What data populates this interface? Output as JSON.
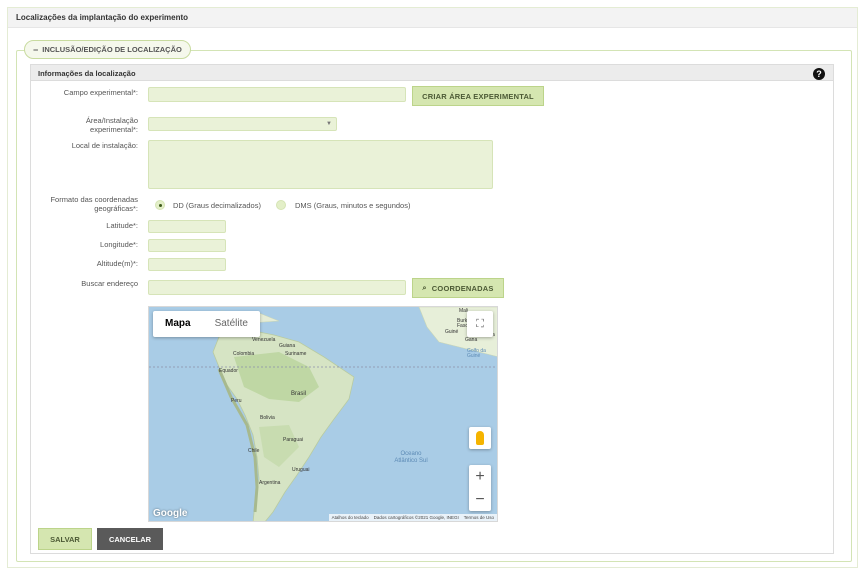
{
  "page": {
    "title": "Localizações da implantação do experimento"
  },
  "section": {
    "legend": "INCLUSÃO/EDIÇÃO DE LOCALIZAÇÃO",
    "collapse_symbol": "−"
  },
  "panel": {
    "title": "Informações da localização",
    "help_symbol": "?"
  },
  "form": {
    "campo_label": "Campo experimental*:",
    "campo_value": "",
    "criar_button": "CRIAR ÁREA EXPERIMENTAL",
    "area_label_line1": "Área/Instalação",
    "area_label_line2": "experimental*:",
    "area_value": "",
    "local_label": "Local de instalação:",
    "local_value": "",
    "formato_label_line1": "Formato das coordenadas",
    "formato_label_line2": "geográficas*:",
    "formato_options": [
      "DD (Graus decimalizados)",
      "DMS (Graus, minutos e segundos)"
    ],
    "formato_selected": "DD (Graus decimalizados)",
    "latitude_label": "Latitude*:",
    "latitude_value": "",
    "longitude_label": "Longitude*:",
    "longitude_value": "",
    "altitude_label": "Altitude(m)*:",
    "altitude_value": "",
    "buscar_label": "Buscar endereço",
    "buscar_value": "",
    "coordenadas_button": "COORDENADAS"
  },
  "map": {
    "tab_map": "Mapa",
    "tab_satellite": "Satélite",
    "active_tab": "Mapa",
    "zoom_in": "+",
    "zoom_out": "−",
    "logo": "Google",
    "footer": [
      "Atalhos do teclado",
      "Dados cartográficos ©2021 Google, INEGI",
      "Termos de Uso"
    ],
    "places": [
      "Venezuela",
      "Colombia",
      "Equador",
      "Suriname",
      "Guiana",
      "Peru",
      "Brasil",
      "Bolivia",
      "Paraguai",
      "Chile",
      "Argentina",
      "Uruguai",
      "Mali",
      "Burkina Faso",
      "Gana",
      "Nigéria",
      "Guiné",
      "Golfo da Guiné"
    ],
    "ocean_line1": "Oceano",
    "ocean_line2": "Atlântico Sul"
  },
  "actions": {
    "save": "SALVAR",
    "cancel": "CANCELAR"
  },
  "colors": {
    "accent": "#d5e6b0",
    "input_bg": "#eaf2d8",
    "cancel_bg": "#5a5a5a"
  }
}
